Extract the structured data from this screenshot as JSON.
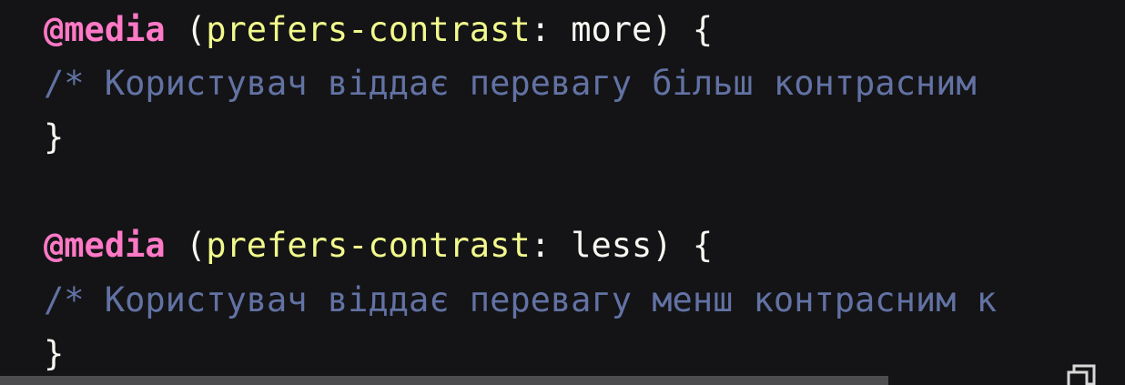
{
  "code": {
    "block1": {
      "at_rule": "@media",
      "open_paren": "(",
      "feature": "prefers-contrast",
      "colon": ":",
      "value": "more",
      "close": ") {",
      "comment": "/* Користувач віддає перевагу більш контрасним",
      "brace_close": "}"
    },
    "block2": {
      "at_rule": "@media",
      "open_paren": "(",
      "feature": "prefers-contrast",
      "colon": ":",
      "value": "less",
      "close": ") {",
      "comment": "/* Користувач віддає перевагу менш контрасним к",
      "brace_close": "}"
    }
  },
  "colors": {
    "background": "#141416",
    "at_rule": "#ff79c6",
    "feature": "#f1fa8c",
    "text": "#f8f8f2",
    "comment": "#6272a4",
    "scrollbar_thumb": "#4d4d4f"
  },
  "scrollbar": {
    "horizontal_visible_fraction": 0.79
  },
  "icons": {
    "copy": "copy-icon"
  }
}
